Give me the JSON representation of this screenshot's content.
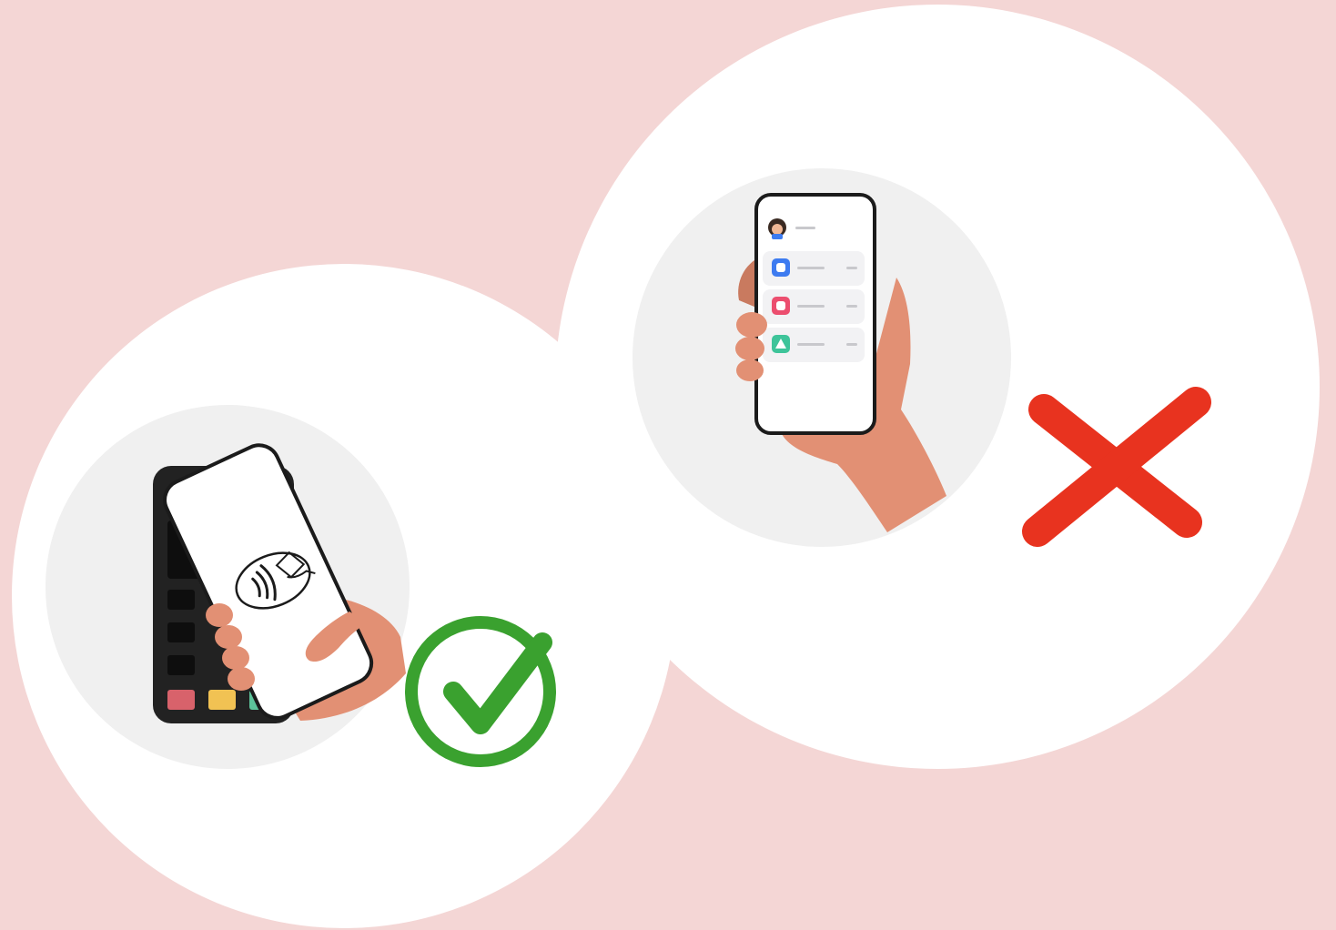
{
  "colors": {
    "background": "#f4d6d5",
    "disc": "#ffffff",
    "inner_disc": "#f0f0f0",
    "skin": "#e29074",
    "skin_shadow": "#c97a5f",
    "outline": "#1b1b1b",
    "terminal_body": "#222222",
    "terminal_key": "#0e0e0e",
    "terminal_pink": "#d8626b",
    "terminal_yellow": "#f1c253",
    "terminal_green": "#5cc39a",
    "check_green": "#3aa12f",
    "cross_red": "#e8331f",
    "app_blue": "#3d7bf0",
    "app_pink": "#ec4e6f",
    "app_green": "#3ec49a",
    "row_bg": "#f2f2f4",
    "line_gray": "#c8c8cc",
    "avatar_hair": "#3a2a22",
    "avatar_skin": "#f1b896"
  },
  "panels": [
    {
      "id": "tap-to-pay",
      "icons": [
        "payment-terminal",
        "smartphone",
        "contactless-payment-icon",
        "hand-icon",
        "checkmark-icon"
      ]
    },
    {
      "id": "phone-app-list",
      "icons": [
        "smartphone",
        "avatar",
        "app-square-icon",
        "app-square-icon",
        "app-triangle-icon",
        "hand-icon",
        "cross-icon"
      ]
    }
  ]
}
